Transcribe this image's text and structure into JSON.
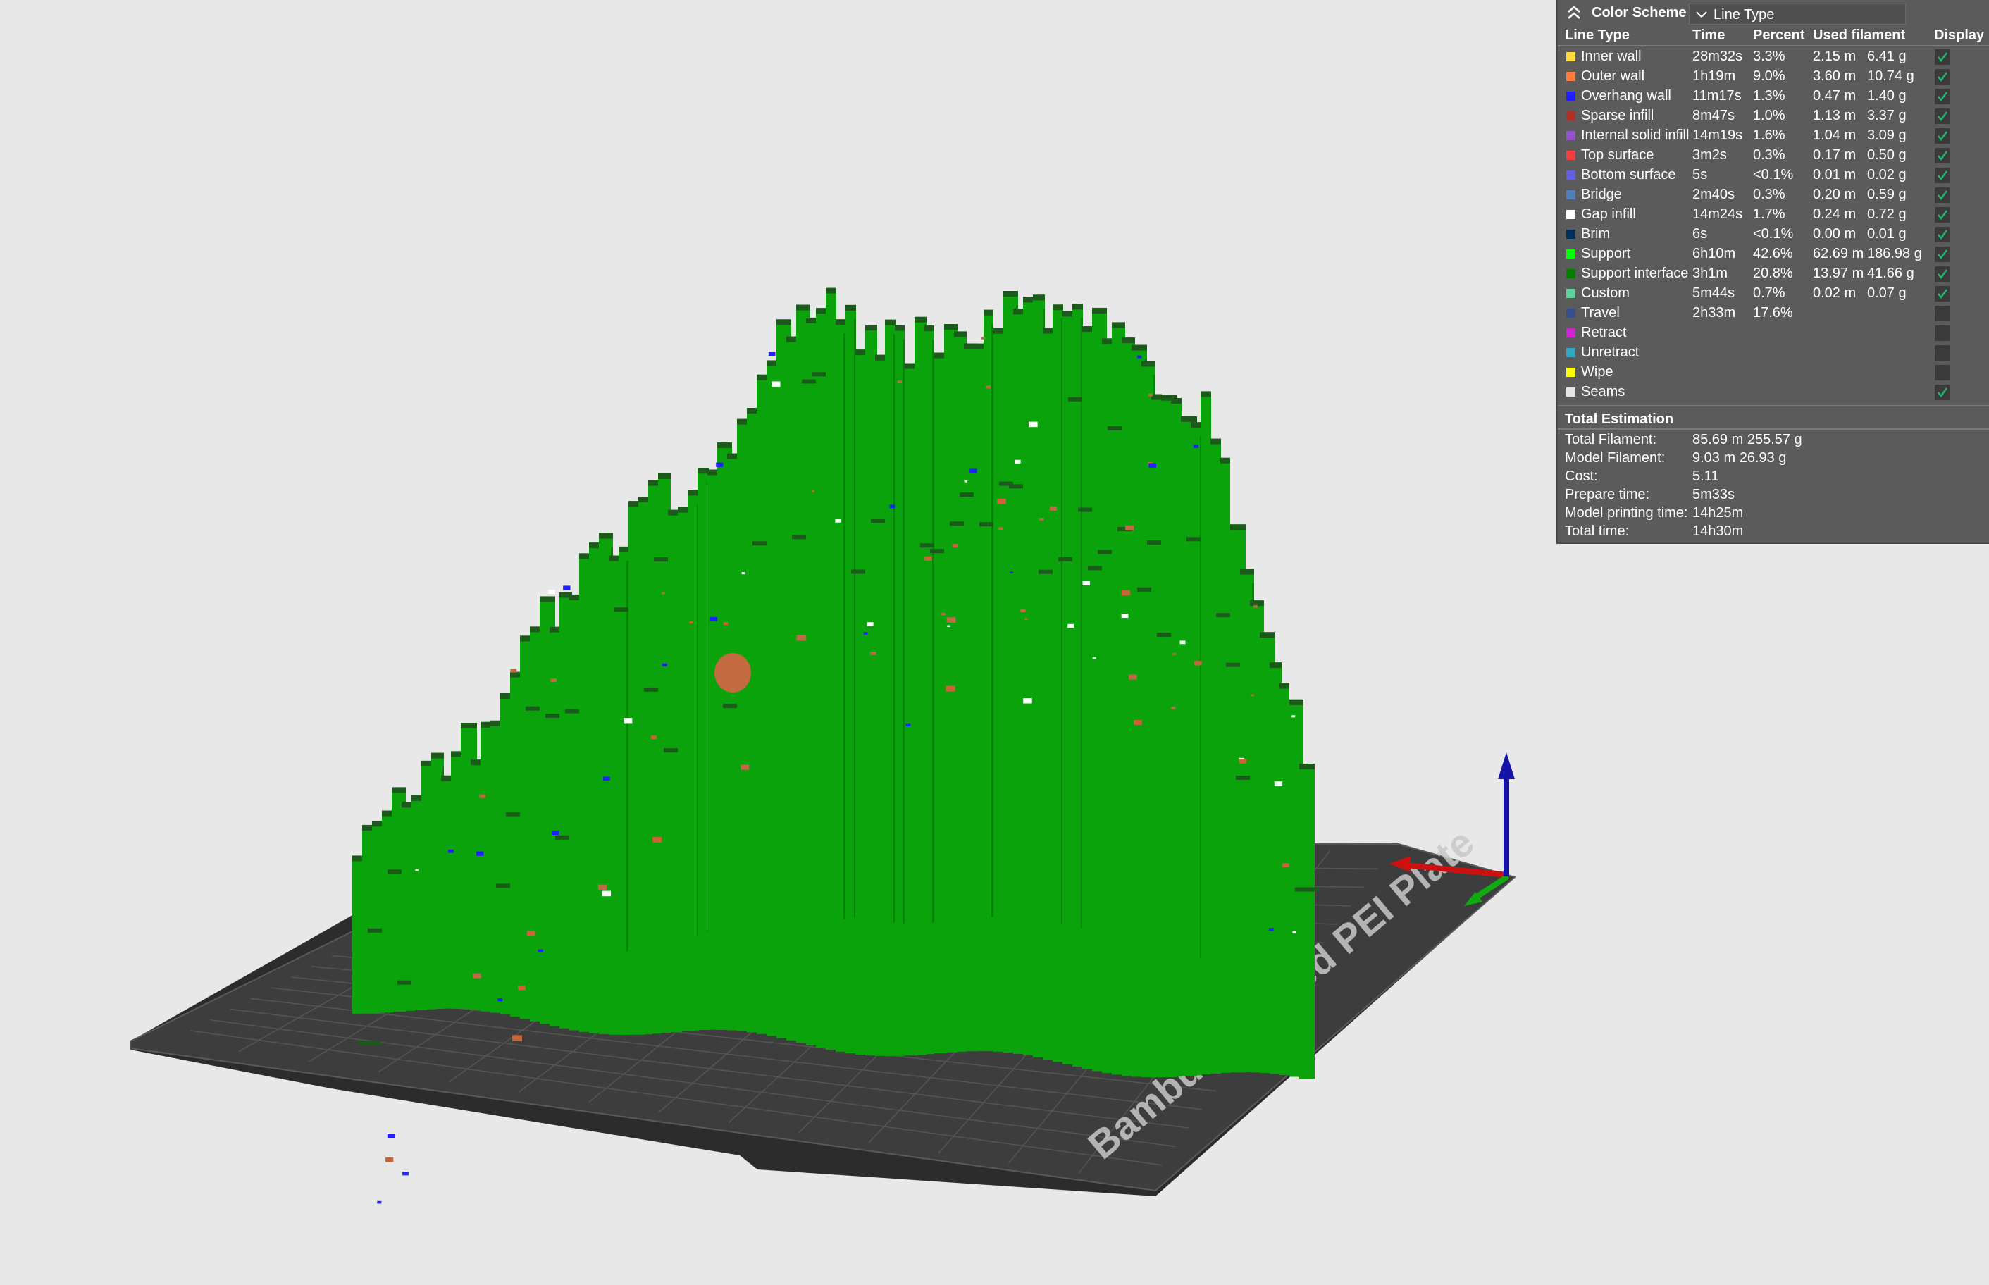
{
  "scene": {
    "plate_label": "Bambu Textured PEI Plate",
    "colors": {
      "background": "#e8e8e8",
      "plate": "#3c3c3c",
      "support_green": "#0ba30b",
      "support_interface": "#1c5a1c",
      "axis_x": "#cc1111",
      "axis_y": "#11aa11",
      "axis_z": "#1414a8"
    }
  },
  "legend": {
    "title": "Color Scheme",
    "collapse_icon": "chevron-up-double-icon",
    "scheme_value": "Line Type",
    "headers": {
      "line_type": "Line Type",
      "time": "Time",
      "percent": "Percent",
      "used_filament": "Used filament",
      "display": "Display"
    },
    "rows": [
      {
        "name": "Inner wall",
        "color": "#ffd83b",
        "time": "28m32s",
        "percent": "3.3%",
        "length": "2.15 m",
        "weight": "6.41 g",
        "display": true
      },
      {
        "name": "Outer wall",
        "color": "#ff7d38",
        "time": "1h19m",
        "percent": "9.0%",
        "length": "3.60 m",
        "weight": "10.74 g",
        "display": true
      },
      {
        "name": "Overhang wall",
        "color": "#1f1fff",
        "time": "11m17s",
        "percent": "1.3%",
        "length": "0.47 m",
        "weight": "1.40 g",
        "display": true
      },
      {
        "name": "Sparse infill",
        "color": "#b03029",
        "time": "8m47s",
        "percent": "1.0%",
        "length": "1.13 m",
        "weight": "3.37 g",
        "display": true
      },
      {
        "name": "Internal solid infill",
        "color": "#9654cc",
        "time": "14m19s",
        "percent": "1.6%",
        "length": "1.04 m",
        "weight": "3.09 g",
        "display": true
      },
      {
        "name": "Top surface",
        "color": "#f04040",
        "time": "3m2s",
        "percent": "0.3%",
        "length": "0.17 m",
        "weight": "0.50 g",
        "display": true
      },
      {
        "name": "Bottom surface",
        "color": "#6060e0",
        "time": "5s",
        "percent": "<0.1%",
        "length": "0.01 m",
        "weight": "0.02 g",
        "display": true
      },
      {
        "name": "Bridge",
        "color": "#4d80ba",
        "time": "2m40s",
        "percent": "0.3%",
        "length": "0.20 m",
        "weight": "0.59 g",
        "display": true
      },
      {
        "name": "Gap infill",
        "color": "#ffffff",
        "time": "14m24s",
        "percent": "1.7%",
        "length": "0.24 m",
        "weight": "0.72 g",
        "display": true
      },
      {
        "name": "Brim",
        "color": "#00305a",
        "time": "6s",
        "percent": "<0.1%",
        "length": "0.00 m",
        "weight": "0.01 g",
        "display": true
      },
      {
        "name": "Support",
        "color": "#00ff00",
        "time": "6h10m",
        "percent": "42.6%",
        "length": "62.69 m",
        "weight": "186.98 g",
        "display": true
      },
      {
        "name": "Support interface",
        "color": "#008000",
        "time": "3h1m",
        "percent": "20.8%",
        "length": "13.97 m",
        "weight": "41.66 g",
        "display": true
      },
      {
        "name": "Custom",
        "color": "#5ed29a",
        "time": "5m44s",
        "percent": "0.7%",
        "length": "0.02 m",
        "weight": "0.07 g",
        "display": true
      },
      {
        "name": "Travel",
        "color": "#384e8f",
        "time": "2h33m",
        "percent": "17.6%",
        "length": "",
        "weight": "",
        "display": false
      },
      {
        "name": "Retract",
        "color": "#d124d1",
        "time": "",
        "percent": "",
        "length": "",
        "weight": "",
        "display": false
      },
      {
        "name": "Unretract",
        "color": "#31a8c0",
        "time": "",
        "percent": "",
        "length": "",
        "weight": "",
        "display": false
      },
      {
        "name": "Wipe",
        "color": "#ffff00",
        "time": "",
        "percent": "",
        "length": "",
        "weight": "",
        "display": false
      },
      {
        "name": "Seams",
        "color": "#e6e6e6",
        "time": "",
        "percent": "",
        "length": "",
        "weight": "",
        "display": true
      }
    ],
    "totals": {
      "title": "Total Estimation",
      "items": [
        {
          "label": "Total Filament:",
          "value": "85.69 m    255.57 g"
        },
        {
          "label": "Model Filament:",
          "value": "9.03 m    26.93 g"
        },
        {
          "label": "Cost:",
          "value": "5.11"
        },
        {
          "label": "Prepare time:",
          "value": "5m33s"
        },
        {
          "label": "Model printing time:",
          "value": "14h25m"
        },
        {
          "label": "Total time:",
          "value": "14h30m"
        }
      ]
    }
  }
}
